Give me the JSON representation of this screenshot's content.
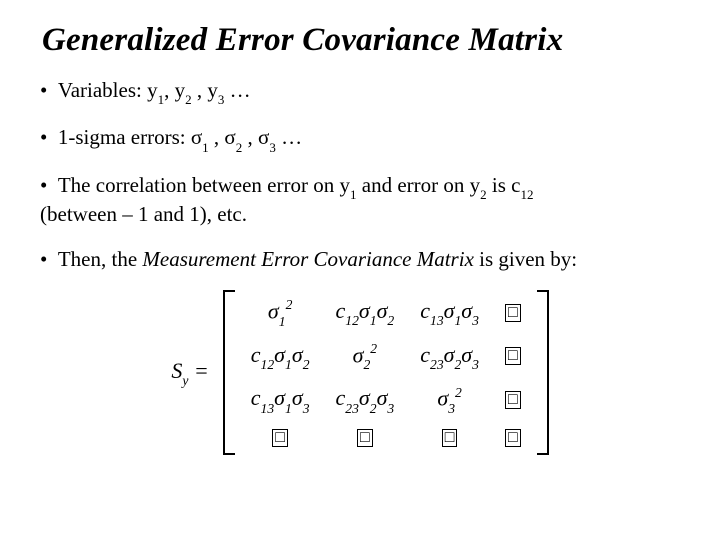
{
  "title": "Generalized Error Covariance Matrix",
  "bullets": {
    "b1_pre": "Variables:  ",
    "b1_y": "y",
    "b1_s1": "1",
    "b1_mid1": ",  ",
    "b1_s2": "2",
    "b1_mid2": " , ",
    "b1_s3": "3",
    "b1_post": " …",
    "b2_pre": "1-sigma errors: ",
    "b2_sig": "σ",
    "b2_s1": "1",
    "b2_mid1": " , ",
    "b2_s2": "2",
    "b2_mid2": " , ",
    "b2_s3": "3",
    "b2_post": " …",
    "b3_pre": "The correlation between error on ",
    "b3_y1": "y",
    "b3_s1": "1",
    "b3_mid": " and error on ",
    "b3_y2": "y",
    "b3_s2": "2",
    "b3_is": " is c",
    "b3_s12": "12",
    "b3_tail": " (between – 1 and 1), etc.",
    "b4_pre": "Then, the ",
    "b4_ital": "Measurement Error Covariance Matrix",
    "b4_post": " is given by:"
  },
  "matrix": {
    "lhs_S": "S",
    "lhs_sub": "y",
    "eq": "  = ",
    "sigma": "σ",
    "c": "c",
    "sup2": "2",
    "s1": "1",
    "s2": "2",
    "s3": "3",
    "s12": "12",
    "s13": "13",
    "s23": "23",
    "box": "□"
  }
}
